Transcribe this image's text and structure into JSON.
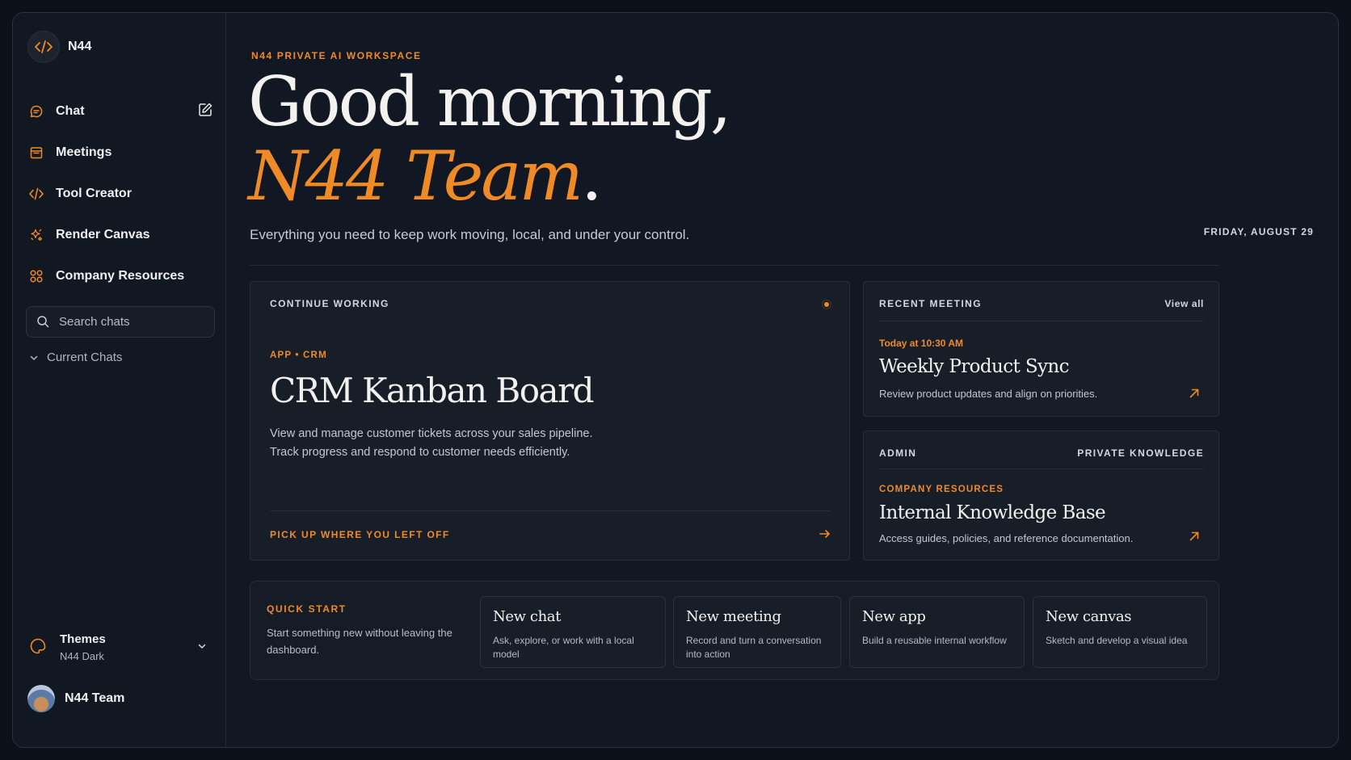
{
  "sidebar": {
    "brand": "N44",
    "items": [
      {
        "label": "Chat",
        "icon": "chat-bubble-icon"
      },
      {
        "label": "Meetings",
        "icon": "calendar-icon"
      },
      {
        "label": "Tool Creator",
        "icon": "code-icon"
      },
      {
        "label": "Render Canvas",
        "icon": "sparkle-icon"
      },
      {
        "label": "Company Resources",
        "icon": "grid-circles-icon"
      }
    ],
    "search_placeholder": "Search chats",
    "current_chats": "Current Chats",
    "themes": {
      "label": "Themes",
      "value": "N44 Dark"
    },
    "user": "N44 Team"
  },
  "header": {
    "eyebrow": "N44 PRIVATE AI WORKSPACE",
    "greeting": "Good morning,",
    "team": "N44 Team",
    "period": ".",
    "subtitle": "Everything you need to keep work moving, local, and under your control.",
    "date": "FRIDAY, AUGUST 29"
  },
  "continue_working": {
    "label": "CONTINUE WORKING",
    "category": "APP • CRM",
    "title": "CRM Kanban Board",
    "desc1": "View and manage customer tickets across your sales pipeline.",
    "desc2": "Track progress and respond to customer needs efficiently.",
    "action": "PICK UP WHERE YOU LEFT OFF"
  },
  "recent_meeting": {
    "label": "RECENT MEETING",
    "view_all": "View all",
    "time": "Today at 10:30 AM",
    "title": "Weekly Product Sync",
    "desc": "Review product updates and align on priorities."
  },
  "admin": {
    "label": "ADMIN",
    "label_right": "PRIVATE KNOWLEDGE",
    "category": "COMPANY RESOURCES",
    "title": "Internal Knowledge Base",
    "desc": "Access guides, policies, and reference documentation."
  },
  "quick_start": {
    "label": "QUICK START",
    "intro": "Start something new without leaving the dashboard.",
    "tiles": [
      {
        "title": "New chat",
        "desc": "Ask, explore, or work with a local model"
      },
      {
        "title": "New meeting",
        "desc": "Record and turn a conversation into action"
      },
      {
        "title": "New app",
        "desc": "Build a reusable internal workflow"
      },
      {
        "title": "New canvas",
        "desc": "Sketch and develop a visual idea"
      }
    ]
  },
  "colors": {
    "accent": "#f08a24",
    "background": "#111823",
    "card": "#171e28"
  }
}
